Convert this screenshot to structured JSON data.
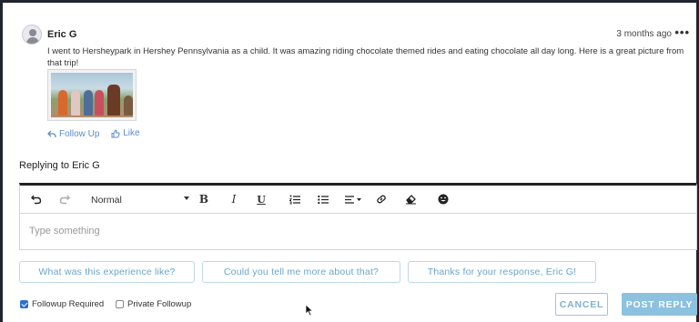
{
  "comment": {
    "author": "Eric G",
    "timestamp": "3 months ago",
    "more_menu": "•••",
    "text": "I went to Hersheypark in Hershey Pennsylvania as a child. It was amazing riding chocolate themed rides and eating chocolate all day long. Here is a great picture from that trip!",
    "actions": {
      "follow_up_label": "Follow Up",
      "like_label": "Like"
    }
  },
  "reply": {
    "heading": "Replying to Eric G",
    "editor": {
      "format_value": "Normal",
      "placeholder": "Type something"
    },
    "suggestions": [
      "What was this experience like?",
      "Could you tell me more about that?",
      "Thanks for your response, Eric G!"
    ],
    "options": {
      "followup_required_label": "Followup Required",
      "followup_required_checked": true,
      "private_followup_label": "Private Followup",
      "private_followup_checked": false
    },
    "buttons": {
      "cancel_label": "CANCEL",
      "post_label": "POST REPLY"
    }
  },
  "colors": {
    "link": "#5b8ec4",
    "suggestion_text": "#6aa5c8",
    "post_button": "#8cc1df",
    "checkbox_checked": "#2f6fcf"
  }
}
